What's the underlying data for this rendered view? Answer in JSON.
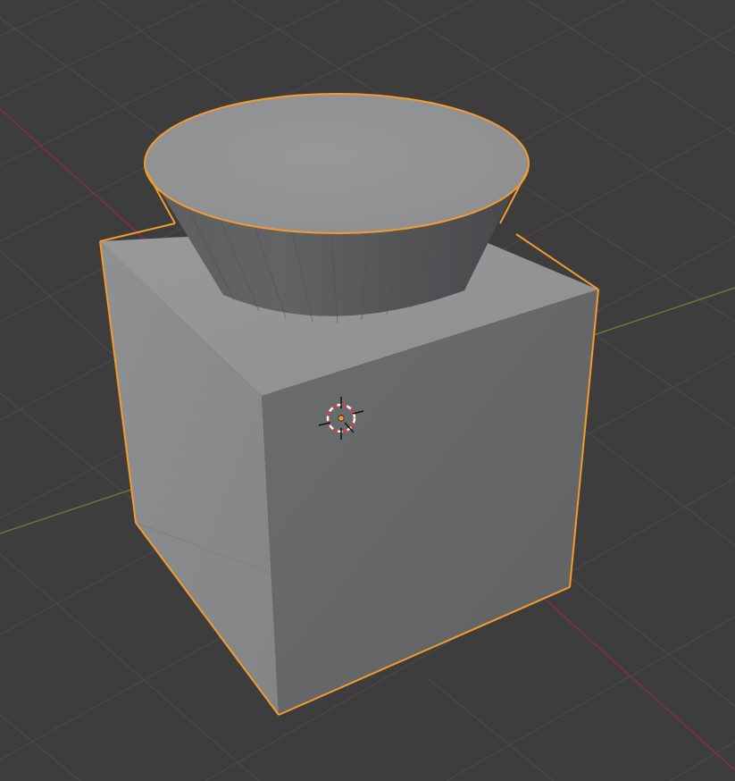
{
  "viewport": {
    "mode": "3D Viewport",
    "shading": "solid",
    "background_color": "#3d3d3d",
    "grid_line_color": "#4a4a4a",
    "x_axis_color": "#7a3340",
    "y_axis_color": "#5e7a2e"
  },
  "scene": {
    "objects": [
      {
        "name": "cube",
        "shape": "cube",
        "selected": true,
        "active": true
      },
      {
        "name": "cone",
        "shape": "truncated-cone",
        "selected": true,
        "active": false
      }
    ],
    "selection_outline_color": "#f59b2e",
    "cursor_icon": "3d-cursor-icon",
    "origin_icon": "object-origin-icon"
  }
}
